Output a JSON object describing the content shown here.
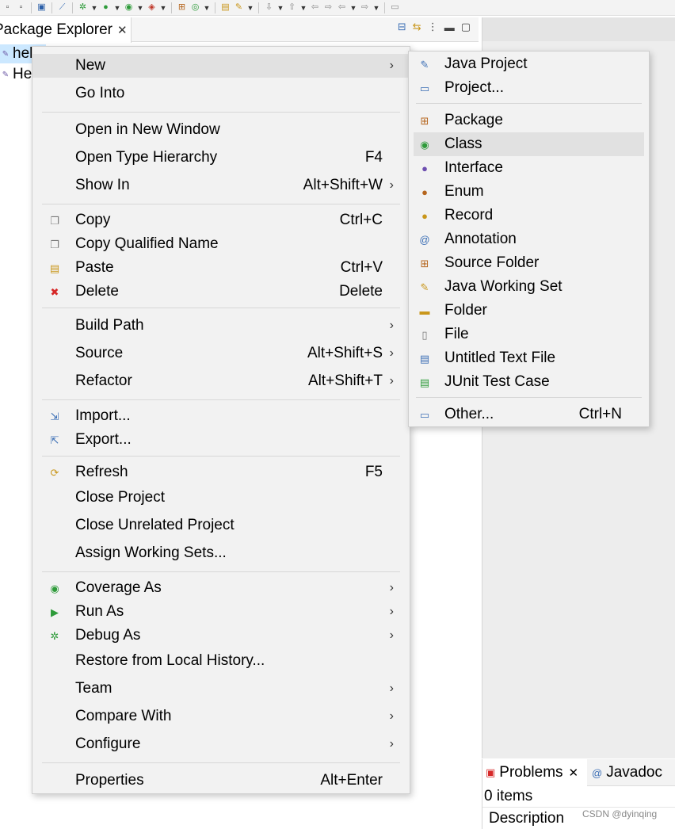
{
  "toolbar": {
    "icons": [
      "save-icon",
      "save-all-icon",
      "terminal-icon",
      "skip-breakpoints-icon",
      "debug-icon",
      "run-icon",
      "coverage-icon",
      "external-tools-icon",
      "new-java-package-icon",
      "new-java-class-icon",
      "open-type-icon",
      "search-icon",
      "next-annotation-icon",
      "prev-annotation-icon",
      "last-edit-icon",
      "back-icon",
      "forward-icon",
      "pin-editor-icon"
    ]
  },
  "explorer": {
    "tab_label": "Package Explorer",
    "tab_close": "✕",
    "tree": [
      {
        "label": "hell",
        "selected": true
      },
      {
        "label": "He",
        "selected": false
      }
    ]
  },
  "context_menu": {
    "items": [
      {
        "label": "New",
        "shortcut": "",
        "submenu": true,
        "icon": ""
      },
      {
        "label": "Go Into",
        "shortcut": "",
        "submenu": false,
        "icon": ""
      },
      {
        "label": "Open in New Window",
        "shortcut": "",
        "submenu": false,
        "icon": ""
      },
      {
        "label": "Open Type Hierarchy",
        "shortcut": "F4",
        "submenu": false,
        "icon": ""
      },
      {
        "label": "Show In",
        "shortcut": "Alt+Shift+W",
        "submenu": true,
        "icon": ""
      },
      {
        "label": "Copy",
        "shortcut": "Ctrl+C",
        "submenu": false,
        "icon": "copy-icon"
      },
      {
        "label": "Copy Qualified Name",
        "shortcut": "",
        "submenu": false,
        "icon": "copy-qualified-icon"
      },
      {
        "label": "Paste",
        "shortcut": "Ctrl+V",
        "submenu": false,
        "icon": "paste-icon"
      },
      {
        "label": "Delete",
        "shortcut": "Delete",
        "submenu": false,
        "icon": "delete-icon"
      },
      {
        "label": "Build Path",
        "shortcut": "",
        "submenu": true,
        "icon": ""
      },
      {
        "label": "Source",
        "shortcut": "Alt+Shift+S",
        "submenu": true,
        "icon": ""
      },
      {
        "label": "Refactor",
        "shortcut": "Alt+Shift+T",
        "submenu": true,
        "icon": ""
      },
      {
        "label": "Import...",
        "shortcut": "",
        "submenu": false,
        "icon": "import-icon"
      },
      {
        "label": "Export...",
        "shortcut": "",
        "submenu": false,
        "icon": "export-icon"
      },
      {
        "label": "Refresh",
        "shortcut": "F5",
        "submenu": false,
        "icon": "refresh-icon"
      },
      {
        "label": "Close Project",
        "shortcut": "",
        "submenu": false,
        "icon": ""
      },
      {
        "label": "Close Unrelated Project",
        "shortcut": "",
        "submenu": false,
        "icon": ""
      },
      {
        "label": "Assign Working Sets...",
        "shortcut": "",
        "submenu": false,
        "icon": ""
      },
      {
        "label": "Coverage As",
        "shortcut": "",
        "submenu": true,
        "icon": "coverage-icon"
      },
      {
        "label": "Run As",
        "shortcut": "",
        "submenu": true,
        "icon": "run-icon"
      },
      {
        "label": "Debug As",
        "shortcut": "",
        "submenu": true,
        "icon": "debug-icon"
      },
      {
        "label": "Restore from Local History...",
        "shortcut": "",
        "submenu": false,
        "icon": ""
      },
      {
        "label": "Team",
        "shortcut": "",
        "submenu": true,
        "icon": ""
      },
      {
        "label": "Compare With",
        "shortcut": "",
        "submenu": true,
        "icon": ""
      },
      {
        "label": "Configure",
        "shortcut": "",
        "submenu": true,
        "icon": ""
      },
      {
        "label": "Properties",
        "shortcut": "Alt+Enter",
        "submenu": false,
        "icon": ""
      }
    ]
  },
  "new_submenu": {
    "items": [
      {
        "label": "Java Project",
        "shortcut": "",
        "icon": "java-project-icon"
      },
      {
        "label": "Project...",
        "shortcut": "",
        "icon": "project-icon"
      },
      {
        "label": "Package",
        "shortcut": "",
        "icon": "package-icon"
      },
      {
        "label": "Class",
        "shortcut": "",
        "icon": "class-icon"
      },
      {
        "label": "Interface",
        "shortcut": "",
        "icon": "interface-icon"
      },
      {
        "label": "Enum",
        "shortcut": "",
        "icon": "enum-icon"
      },
      {
        "label": "Record",
        "shortcut": "",
        "icon": "record-icon"
      },
      {
        "label": "Annotation",
        "shortcut": "",
        "icon": "annotation-icon"
      },
      {
        "label": "Source Folder",
        "shortcut": "",
        "icon": "source-folder-icon"
      },
      {
        "label": "Java Working Set",
        "shortcut": "",
        "icon": "java-working-set-icon"
      },
      {
        "label": "Folder",
        "shortcut": "",
        "icon": "folder-icon"
      },
      {
        "label": "File",
        "shortcut": "",
        "icon": "file-icon"
      },
      {
        "label": "Untitled Text File",
        "shortcut": "",
        "icon": "untitled-text-file-icon"
      },
      {
        "label": "JUnit Test Case",
        "shortcut": "",
        "icon": "junit-icon"
      },
      {
        "label": "Other...",
        "shortcut": "Ctrl+N",
        "icon": "other-icon"
      }
    ]
  },
  "problems_panel": {
    "tabs": [
      {
        "label": "Problems",
        "close": "✕"
      },
      {
        "label": "Javadoc"
      }
    ],
    "items_count": "0 items",
    "column_header": "Description"
  },
  "watermark": "CSDN @dyinqing"
}
